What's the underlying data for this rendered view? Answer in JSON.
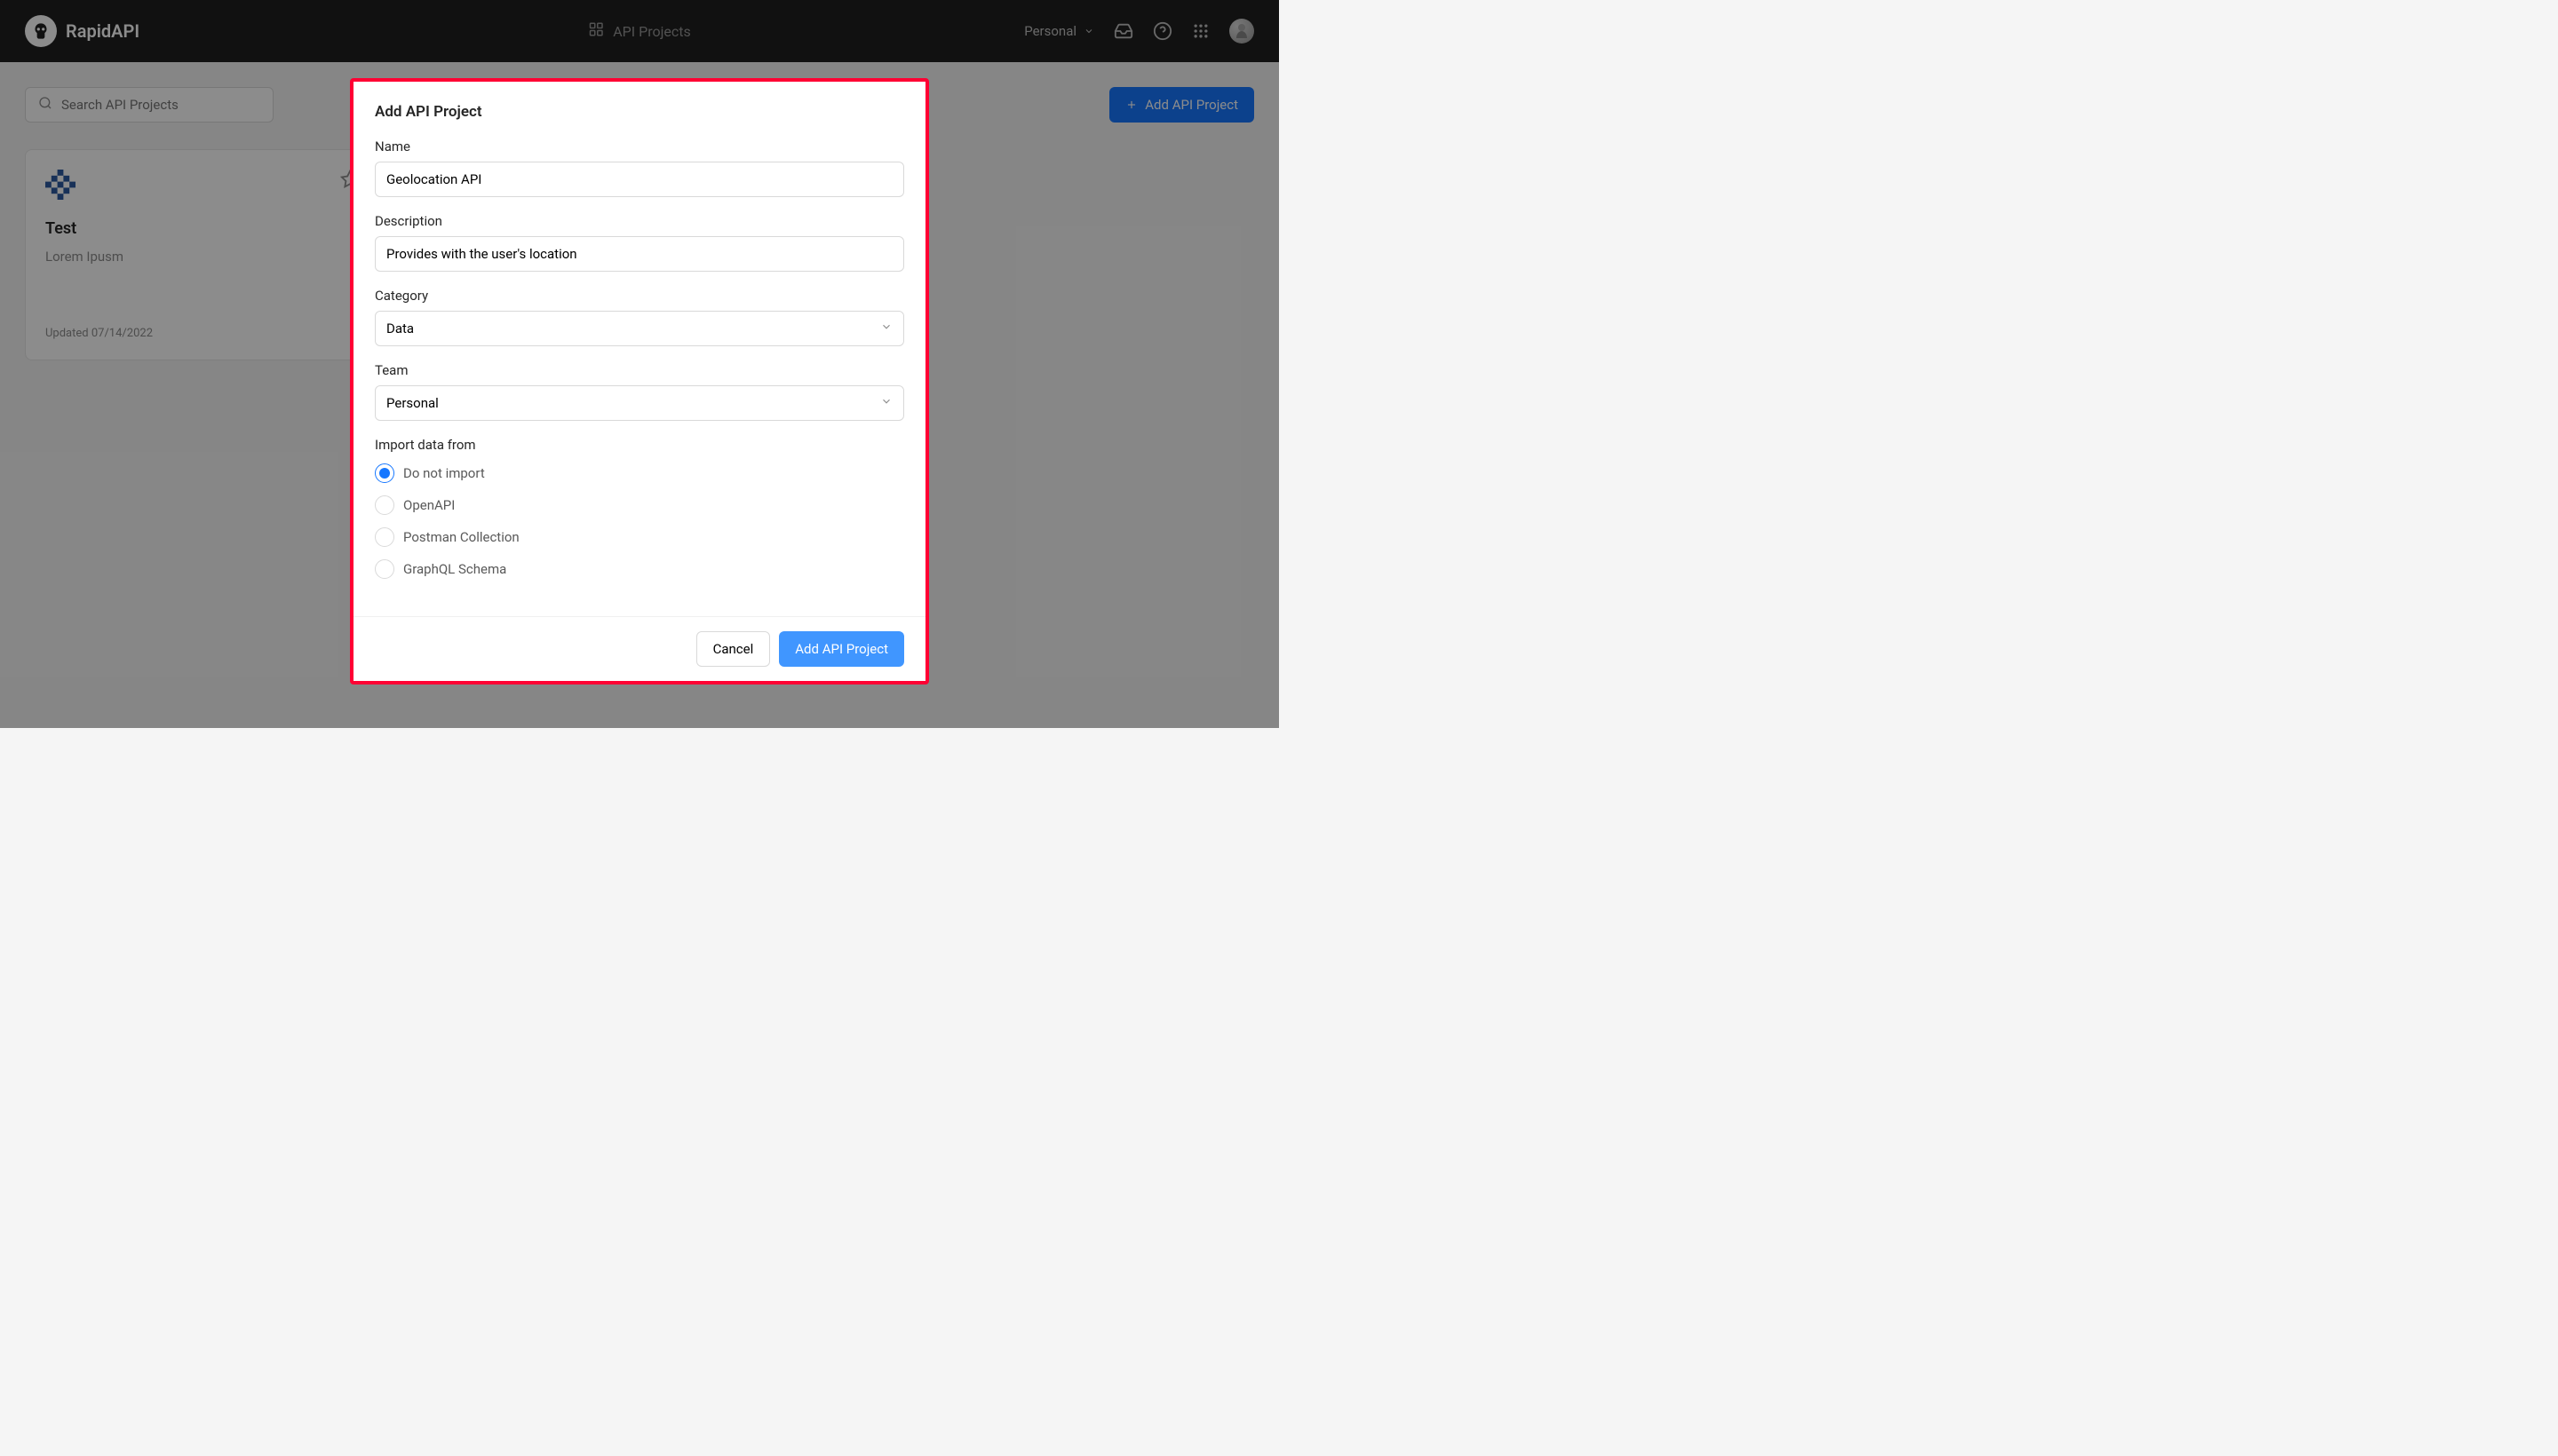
{
  "header": {
    "brand": "RapidAPI",
    "nav_title": "API Projects",
    "workspace": "Personal"
  },
  "toolbar": {
    "search_placeholder": "Search API Projects",
    "add_button": "Add API Project"
  },
  "project_card": {
    "title": "Test",
    "description": "Lorem Ipusm",
    "updated": "Updated 07/14/2022"
  },
  "modal": {
    "title": "Add API Project",
    "name_label": "Name",
    "name_value": "Geolocation API",
    "desc_label": "Description",
    "desc_value": "Provides with the user's location",
    "category_label": "Category",
    "category_value": "Data",
    "team_label": "Team",
    "team_value": "Personal",
    "import_label": "Import data from",
    "import_options": {
      "opt0": "Do not import",
      "opt1": "OpenAPI",
      "opt2": "Postman Collection",
      "opt3": "GraphQL Schema"
    },
    "cancel": "Cancel",
    "submit": "Add API Project"
  }
}
